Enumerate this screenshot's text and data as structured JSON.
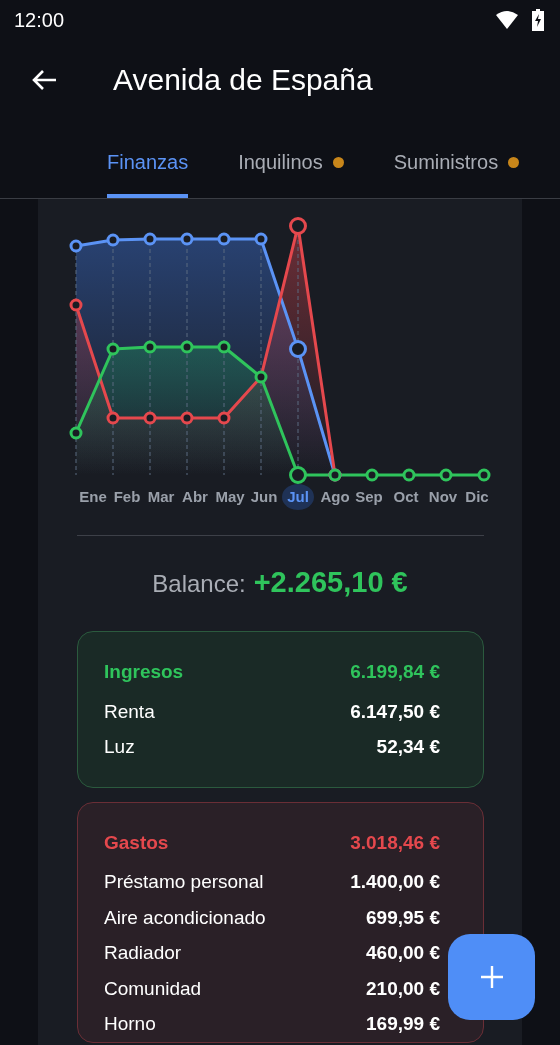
{
  "status_bar": {
    "time": "12:00"
  },
  "app_bar": {
    "title": "Avenida de España"
  },
  "tabs": [
    {
      "label": "Finanzas",
      "selected": true,
      "dot": false
    },
    {
      "label": "Inquilinos",
      "selected": false,
      "dot": true
    },
    {
      "label": "Suministros",
      "selected": false,
      "dot": true
    }
  ],
  "chart": {
    "months": [
      {
        "label": "Ene",
        "selected": false
      },
      {
        "label": "Feb",
        "selected": false
      },
      {
        "label": "Mar",
        "selected": false
      },
      {
        "label": "Abr",
        "selected": false
      },
      {
        "label": "May",
        "selected": false
      },
      {
        "label": "Jun",
        "selected": false
      },
      {
        "label": "Jul",
        "selected": true
      },
      {
        "label": "Ago",
        "selected": false
      },
      {
        "label": "Sep",
        "selected": false
      },
      {
        "label": "Oct",
        "selected": false
      },
      {
        "label": "Nov",
        "selected": false
      },
      {
        "label": "Dic",
        "selected": false
      }
    ]
  },
  "balance": {
    "label": "Balance:",
    "amount": "+2.265,10 €"
  },
  "sections": [
    {
      "kind": "income",
      "title": "Ingresos",
      "total": "6.199,84 €",
      "items": [
        {
          "name": "Renta",
          "amount": "6.147,50 €"
        },
        {
          "name": "Luz",
          "amount": "52,34 €"
        }
      ]
    },
    {
      "kind": "expense",
      "title": "Gastos",
      "total": "3.018,46 €",
      "items": [
        {
          "name": "Préstamo personal",
          "amount": "1.400,00 €"
        },
        {
          "name": "Aire acondicionado",
          "amount": "699,95 €"
        },
        {
          "name": "Radiador",
          "amount": "460,00 €"
        },
        {
          "name": "Comunidad",
          "amount": "210,00 €"
        },
        {
          "name": "Horno",
          "amount": "169,99 €"
        }
      ]
    }
  ]
}
